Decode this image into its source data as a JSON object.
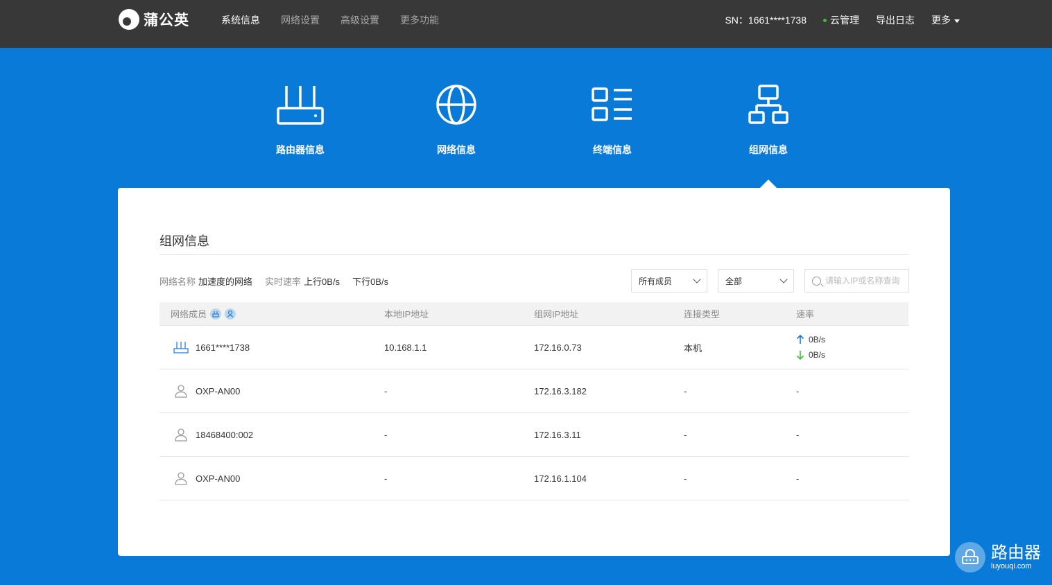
{
  "brand": {
    "name": "蒲公英"
  },
  "nav": {
    "items": [
      {
        "label": "系统信息",
        "active": true
      },
      {
        "label": "网络设置",
        "active": false
      },
      {
        "label": "高级设置",
        "active": false
      },
      {
        "label": "更多功能",
        "active": false
      }
    ],
    "sn": "SN：1661****1738",
    "cloud": "云管理",
    "export_log": "导出日志",
    "more": "更多"
  },
  "features": [
    {
      "label": "路由器信息",
      "icon": "router-icon"
    },
    {
      "label": "网络信息",
      "icon": "globe-icon"
    },
    {
      "label": "终端信息",
      "icon": "terminal-list-icon"
    },
    {
      "label": "组网信息",
      "icon": "network-topology-icon"
    }
  ],
  "panel": {
    "title": "组网信息",
    "network_name_label": "网络名称",
    "network_name": "加速度的网络",
    "rate_label": "实时速率",
    "up_rate": "上行0B/s",
    "down_rate": "下行0B/s",
    "filter_members": "所有成员",
    "filter_type": "全部",
    "search_placeholder": "请输入IP或名称查询"
  },
  "table": {
    "headers": [
      "网络成员",
      "本地IP地址",
      "组网IP地址",
      "连接类型",
      "速率"
    ],
    "rows": [
      {
        "icon": "router-icon",
        "name": "1661****1738",
        "local_ip": "10.168.1.1",
        "vpn_ip": "172.16.0.73",
        "type": "本机",
        "up": "0B/s",
        "down": "0B/s"
      },
      {
        "icon": "user-icon",
        "name": "OXP-AN00",
        "local_ip": "-",
        "vpn_ip": "172.16.3.182",
        "type": "-",
        "speed": "-"
      },
      {
        "icon": "user-icon",
        "name": "18468400:002",
        "local_ip": "-",
        "vpn_ip": "172.16.3.11",
        "type": "-",
        "speed": "-"
      },
      {
        "icon": "user-icon",
        "name": "OXP-AN00",
        "local_ip": "-",
        "vpn_ip": "172.16.1.104",
        "type": "-",
        "speed": "-"
      }
    ]
  },
  "watermark": {
    "title": "路由器",
    "url": "luyouqi.com"
  },
  "colors": {
    "topbar": "#383838",
    "background": "#0a7ad9",
    "online": "#35c335",
    "up_arrow": "#1a73d9",
    "down_arrow": "#3dbb3d"
  }
}
